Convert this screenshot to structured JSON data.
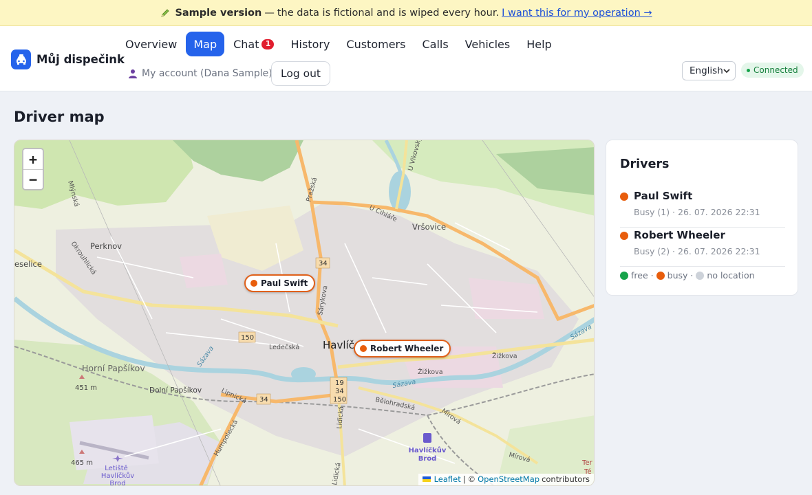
{
  "banner": {
    "title": "Sample version",
    "text": "the data is fictional and is wiped every hour.",
    "dash": "—",
    "link": "I want this for my operation →"
  },
  "brand": {
    "name": "Můj dispečink"
  },
  "nav": {
    "items": [
      {
        "label": "Overview"
      },
      {
        "label": "Map"
      },
      {
        "label": "Chat",
        "badge": "1"
      },
      {
        "label": "History"
      },
      {
        "label": "Customers"
      },
      {
        "label": "Calls"
      },
      {
        "label": "Vehicles"
      },
      {
        "label": "Help"
      }
    ],
    "active": "Map"
  },
  "account": {
    "label": "My account (Dana Sample)",
    "logout": "Log out"
  },
  "language": {
    "selected": "English"
  },
  "connection": {
    "status": "Connected"
  },
  "page": {
    "title": "Driver map"
  },
  "map": {
    "zoom_in": "+",
    "zoom_out": "−",
    "markers": [
      {
        "name": "Paul Swift",
        "status_color": "#e85d0c"
      },
      {
        "name": "Robert Wheeler",
        "status_color": "#e85d0c"
      }
    ],
    "labels": {
      "city": "Havlíčkův Brod",
      "city_short": "Havlíč",
      "perknov": "Perknov",
      "vrsovice": "Vršovice",
      "horni_papsikov": "Horní Papšíkov",
      "dolni_papsikov": "Dolní Papšíkov",
      "selice": "eselice",
      "airport": [
        "Letiště",
        "Havlíčkův",
        "Brod"
      ],
      "station": [
        "Havlíčkův",
        "Brod"
      ],
      "elev1": "451 m",
      "elev2": "465 m",
      "sazava": "Sázava",
      "street_prazska": "Pražská",
      "street_sarykova": "Sárykova",
      "street_u_cihlare": "U Cihláře",
      "street_u_vikovsky": "U Vikovský",
      "street_ledecska": "Ledečská",
      "street_zizkova": "Žižkova",
      "street_belohradska": "Bělohradská",
      "street_mirova": "Mírová",
      "street_lipnicka": "Lipnická",
      "street_humpolecka": "Humpolecká",
      "street_lidicka": "Lidická",
      "street_okrouhlicka": "Okrouhlická",
      "street_mlynska": "Mlýnská",
      "road_34": "34",
      "road_150": "150",
      "road_19": "19",
      "ter": "Ter",
      "ter2": "Té"
    },
    "attribution": {
      "leaflet": "Leaflet",
      "sep": "|",
      "copy": "©",
      "osm": "OpenStreetMap",
      "contributors": "contributors"
    }
  },
  "drivers": {
    "title": "Drivers",
    "list": [
      {
        "name": "Paul Swift",
        "meta": "Busy (1) · 26. 07. 2026 22:31",
        "color": "#e85d0c"
      },
      {
        "name": "Robert Wheeler",
        "meta": "Busy (2) · 26. 07. 2026 22:31",
        "color": "#e85d0c"
      }
    ],
    "legend": [
      {
        "label": "free",
        "color": "#16a34a"
      },
      {
        "label": "busy",
        "color": "#e85d0c"
      },
      {
        "label": "no location",
        "color": "#cdd2d9"
      }
    ],
    "legend_sep": "·"
  },
  "colors": {
    "accent": "#2563eb",
    "busy": "#e85d0c",
    "free": "#16a34a",
    "badge": "#e11d2e"
  }
}
